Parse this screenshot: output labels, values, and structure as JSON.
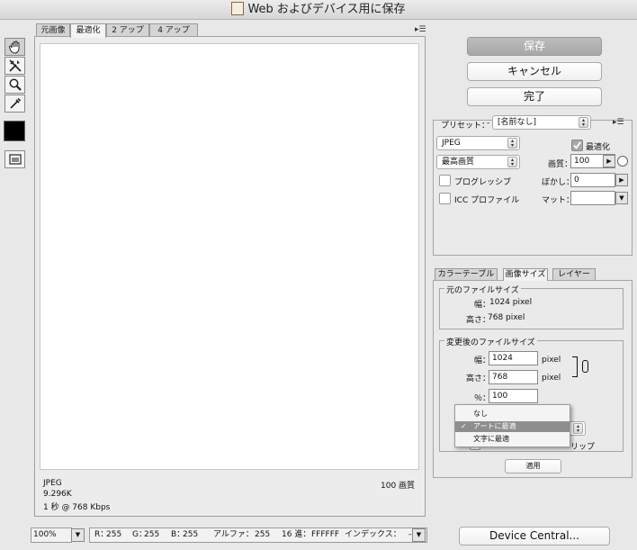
{
  "window": {
    "title": "Web およびデバイス用に保存"
  },
  "tabs": [
    "元画像",
    "最適化",
    "2 アップ",
    "4 アップ"
  ],
  "tools": [
    "hand-icon",
    "slice-select-icon",
    "zoom-icon",
    "eyedropper-icon"
  ],
  "preview": {
    "format": "JPEG",
    "size": "9.296K",
    "speed": "1 秒 @ 768 Kbps",
    "quality_label": "100 画質"
  },
  "buttons": {
    "save": "保存",
    "cancel": "キャンセル",
    "done": "完了",
    "apply": "適用",
    "device_central": "Device Central..."
  },
  "settings": {
    "preset_label": "プリセット：",
    "preset_dash": "-",
    "preset_value": "[名前なし]",
    "format_value": "JPEG",
    "quality_preset": "最高画質",
    "optimize_label": "最適化",
    "quality_label": "画質：",
    "quality_value": "100",
    "progressive_label": "プログレッシブ",
    "blur_label": "ぼかし：",
    "blur_value": "0",
    "icc_label": "ICC プロファイル",
    "matte_label": "マット："
  },
  "lower_tabs": [
    "カラーテーブル",
    "画像サイズ",
    "レイヤー"
  ],
  "image_size": {
    "original_legend": "元のファイルサイズ",
    "orig_width_label": "幅：",
    "orig_width_value": "1024 pixel",
    "orig_height_label": "高さ：",
    "orig_height_value": "768 pixel",
    "new_legend": "変更後のファイルサイズ",
    "width_label": "幅：",
    "width_value": "1024",
    "height_label": "高さ：",
    "height_value": "768",
    "unit": "pixel",
    "percent_label": "％：",
    "percent_value": "100",
    "clip_suffix": "リップ"
  },
  "quality_menu": {
    "options": [
      "なし",
      "アートに最適",
      "文字に最適"
    ],
    "selected": "アートに最適",
    "check": "✓"
  },
  "status": {
    "zoom": "100%",
    "r_label": "R：",
    "r_value": "255",
    "g_label": "G：",
    "g_value": "255",
    "b_label": "B：",
    "b_value": "255",
    "alpha_label": "アルファ：",
    "alpha_value": "255",
    "hex_label": "16 進：",
    "hex_value": "FFFFFF",
    "index_label": "インデックス：",
    "index_value": "--"
  }
}
